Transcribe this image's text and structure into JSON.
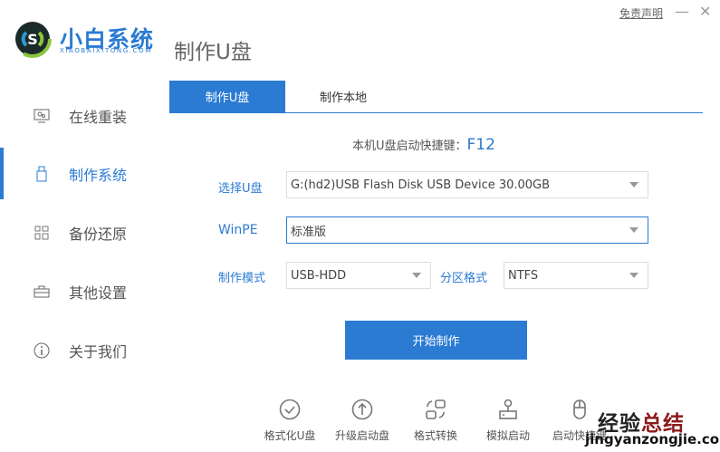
{
  "app": {
    "name": "小白系统",
    "subtitle": "XIAOBAIXITONG.COM",
    "page_title": "制作U盘",
    "disclaimer": "免责声明",
    "minimize": "—",
    "close": "✕"
  },
  "sidebar": {
    "items": [
      {
        "label": "在线重装",
        "icon": "monitor-icon"
      },
      {
        "label": "制作系统",
        "icon": "usb-icon",
        "active": true
      },
      {
        "label": "备份还原",
        "icon": "grid-icon"
      },
      {
        "label": "其他设置",
        "icon": "briefcase-icon"
      },
      {
        "label": "关于我们",
        "icon": "info-icon"
      }
    ]
  },
  "tabs": [
    {
      "label": "制作U盘",
      "active": true
    },
    {
      "label": "制作本地",
      "active": false
    }
  ],
  "hotkey": {
    "label": "本机U盘启动快捷键：",
    "key": "F12"
  },
  "form": {
    "usb_label": "选择U盘",
    "usb_value": "G:(hd2)USB Flash Disk USB Device 30.00GB",
    "winpe_label": "WinPE",
    "winpe_value": "标准版",
    "mode_label": "制作模式",
    "mode_value": "USB-HDD",
    "partition_label": "分区格式",
    "partition_value": "NTFS"
  },
  "start_button": "开始制作",
  "tools": [
    {
      "label": "格式化U盘",
      "icon": "check-circle-icon"
    },
    {
      "label": "升级启动盘",
      "icon": "arrow-up-circle-icon"
    },
    {
      "label": "格式转换",
      "icon": "convert-icon"
    },
    {
      "label": "模拟启动",
      "icon": "stamp-icon"
    },
    {
      "label": "启动快捷键",
      "icon": "mouse-icon"
    }
  ],
  "watermark": {
    "cn_black": "经验",
    "cn_red": "总结",
    "url": "jingyanzongjie.com"
  },
  "colors": {
    "accent": "#2b7bd3"
  }
}
